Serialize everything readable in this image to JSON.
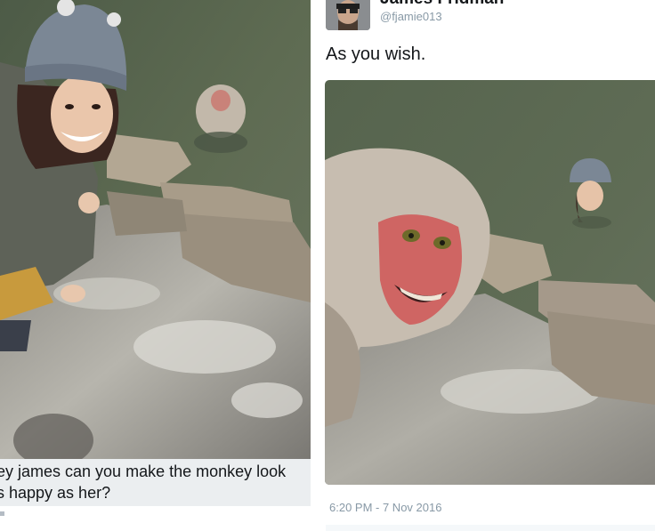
{
  "left": {
    "caption": "ey james can you make the monkey look\ns happy as her?"
  },
  "tweet": {
    "display_name": "James Fridman",
    "handle": "@fjamie013",
    "text": "As you wish.",
    "timestamp": "6:20 PM - 7 Nov 2016"
  }
}
